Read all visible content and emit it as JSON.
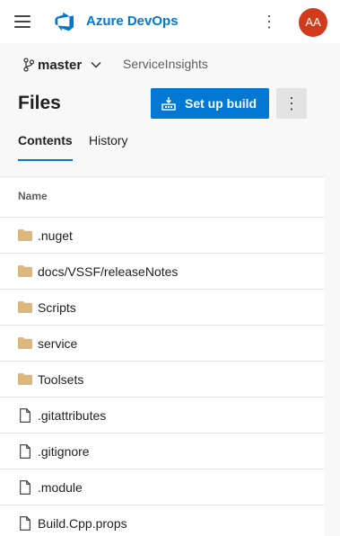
{
  "header": {
    "brand": "Azure DevOps",
    "avatar_initials": "AA",
    "more_symbol": "⋮"
  },
  "repo": {
    "branch": "master",
    "name": "ServiceInsights"
  },
  "page": {
    "title": "Files",
    "setup_build_label": "Set up build",
    "more_symbol": "⋮"
  },
  "tabs": [
    {
      "label": "Contents",
      "selected": true
    },
    {
      "label": "History",
      "selected": false
    }
  ],
  "table": {
    "column": "Name",
    "rows": [
      {
        "name": ".nuget",
        "type": "folder"
      },
      {
        "name": "docs/VSSF/releaseNotes",
        "type": "folder"
      },
      {
        "name": "Scripts",
        "type": "folder"
      },
      {
        "name": "service",
        "type": "folder"
      },
      {
        "name": "Toolsets",
        "type": "folder"
      },
      {
        "name": ".gitattributes",
        "type": "file"
      },
      {
        "name": ".gitignore",
        "type": "file"
      },
      {
        "name": ".module",
        "type": "file"
      },
      {
        "name": "Build.Cpp.props",
        "type": "file"
      }
    ]
  },
  "colors": {
    "accent": "#0078d4",
    "avatar": "#d13b1a",
    "folder": "#dcb67a"
  }
}
